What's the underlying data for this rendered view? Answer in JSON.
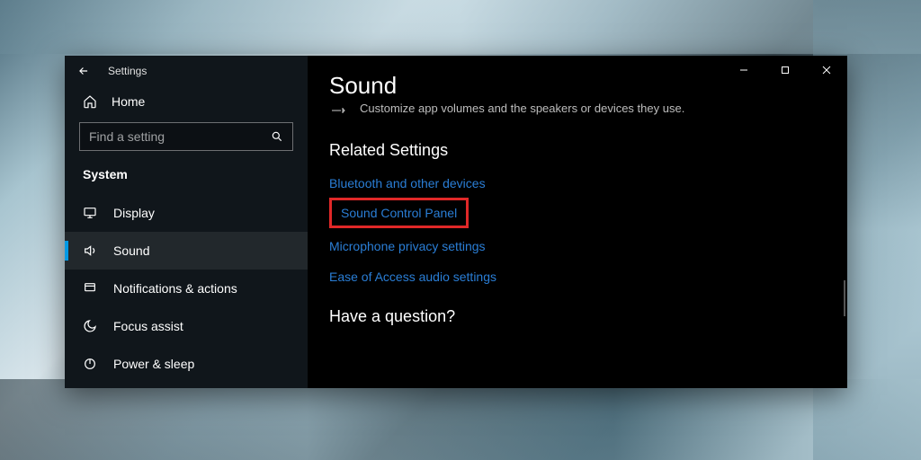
{
  "window": {
    "title": "Settings"
  },
  "sidebar": {
    "home": "Home",
    "search_placeholder": "Find a setting",
    "category": "System",
    "items": [
      {
        "label": "Display"
      },
      {
        "label": "Sound"
      },
      {
        "label": "Notifications & actions"
      },
      {
        "label": "Focus assist"
      },
      {
        "label": "Power & sleep"
      }
    ]
  },
  "main": {
    "title": "Sound",
    "description": "Customize app volumes and the speakers or devices they use.",
    "related_heading": "Related Settings",
    "links": {
      "bluetooth": "Bluetooth and other devices",
      "sound_cp": "Sound Control Panel",
      "mic_privacy": "Microphone privacy settings",
      "ease_audio": "Ease of Access audio settings"
    },
    "question_heading": "Have a question?"
  }
}
